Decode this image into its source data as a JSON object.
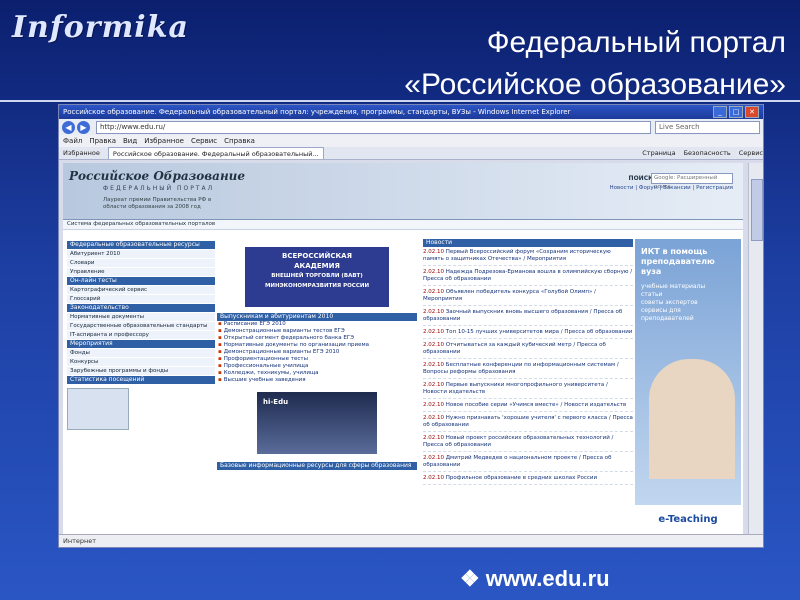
{
  "slide": {
    "logo": "Informika",
    "title_line1": "Федеральный портал",
    "title_line2": "«Российское образование»",
    "footer_bullet": "❖",
    "footer_url": "www.edu.ru"
  },
  "browser": {
    "title": "Российское образование. Федеральный образовательный портал: учреждения, программы, стандарты, ВУЗы - Windows Internet Explorer",
    "win_buttons": [
      "_",
      "□",
      "✕"
    ],
    "back_label": "◀",
    "forward_label": "▶",
    "url": "http://www.edu.ru/",
    "search_placeholder": "Live Search",
    "menu": [
      "Файл",
      "Правка",
      "Вид",
      "Избранное",
      "Сервис",
      "Справка"
    ],
    "fav_label": "Избранное",
    "tab_label": "Российское образование. Федеральный образовательный...",
    "tools": [
      "Страница",
      "Безопасность",
      "Сервис"
    ],
    "status": "Интернет"
  },
  "site": {
    "logo": "Российское Образование",
    "subtitle": "ФЕДЕРАЛЬНЫЙ ПОРТАЛ",
    "banner": "Лауреат премии Правительства РФ в области образования за 2008 год",
    "search_label": "ПОИСК",
    "search_placeholder": "Google: Расширенный поиск",
    "links": "Новости | Форум | Вакансии | Регистрация",
    "crumb": "Система федеральных образовательных порталов"
  },
  "left_nav": [
    {
      "text": "Федеральные образовательные ресурсы",
      "kind": "head"
    },
    {
      "text": "Абитуриент 2010",
      "kind": "item"
    },
    {
      "text": "Словари",
      "kind": "item"
    },
    {
      "text": "Управление",
      "kind": "item"
    },
    {
      "text": "Он-лайн тесты",
      "kind": "head"
    },
    {
      "text": "Картографический сервис",
      "kind": "item"
    },
    {
      "text": "Глоссарий",
      "kind": "item"
    },
    {
      "text": "Законодательство",
      "kind": "head"
    },
    {
      "text": "Нормативные документы",
      "kind": "item"
    },
    {
      "text": "Государственные образовательные стандарты",
      "kind": "item"
    },
    {
      "text": "IT-аспиранта и профессору",
      "kind": "item"
    },
    {
      "text": "Мероприятия",
      "kind": "head"
    },
    {
      "text": "Фонды",
      "kind": "item"
    },
    {
      "text": "Конкурсы",
      "kind": "item"
    },
    {
      "text": "Зарубежные программы и фонды",
      "kind": "item"
    },
    {
      "text": "Статистика посещений",
      "kind": "head"
    }
  ],
  "mid": {
    "banner_line1": "ВСЕРОССИЙСКАЯ",
    "banner_line2": "АКАДЕМИЯ",
    "banner_line3": "ВНЕШНЕЙ ТОРГОВЛИ (ВАВТ)",
    "banner_line4": "МИНЭКОНОМРАЗВИТИЯ РОССИИ",
    "head": "Выпускникам и абитуриентам 2010",
    "items": [
      "Расписание ЕГЭ 2010",
      "Демонстрационные варианты тестов ЕГЭ",
      "Открытый сегмент федерального банка ЕГЭ",
      "Нормативные документы по организации приема",
      "Демонстрационные варианты ЕГЭ 2010",
      "Профориентационные тесты",
      "Профессиональные училища",
      "Колледжи, техникумы, училища",
      "Высшие учебные заведения"
    ],
    "photo_label": "hi-Edu",
    "bottom_head": "Базовые информационные ресурсы для сферы образования"
  },
  "news": {
    "head": "Новости",
    "items": [
      {
        "date": "2.02.10",
        "text": "Первый Всероссийский форум «Сохраним историческую память о защитниках Отечества» / Мероприятия"
      },
      {
        "date": "2.02.10",
        "text": "Надежда Подрезова-Ерманова вошла в олимпийскую сборную / Пресса об образовании"
      },
      {
        "date": "2.02.10",
        "text": "Объявлен победитель конкурса «Голубой Олимп» / Мероприятия"
      },
      {
        "date": "2.02.10",
        "text": "Заочный выпускник вновь высшего образования / Пресса об образовании"
      },
      {
        "date": "2.02.10",
        "text": "Топ 10-15 лучших университетов мира / Пресса об образовании"
      },
      {
        "date": "2.02.10",
        "text": "Отчитываться за каждый кубический метр / Пресса об образовании"
      },
      {
        "date": "2.02.10",
        "text": "Бесплатные конференции по информационным системам / Вопросы реформы образования"
      },
      {
        "date": "2.02.10",
        "text": "Первые выпускники многопрофильного университета / Новости издательств"
      },
      {
        "date": "2.02.10",
        "text": "Новое пособие серии «Учимся вместе» / Новости издательств"
      },
      {
        "date": "2.02.10",
        "text": "Нужно признавать 'хорошие учителя' с первого класса / Пресса об образовании"
      },
      {
        "date": "2.02.10",
        "text": "Новый проект российских образовательных технологий / Пресса об образовании"
      },
      {
        "date": "2.02.10",
        "text": "Дмитрий Медведев о национальном проекте / Пресса об образовании"
      },
      {
        "date": "2.02.10",
        "text": "Профильное образование в средних школах России"
      }
    ]
  },
  "ad": {
    "title": "ИКТ в помощь преподавателю вуза",
    "items": [
      "учебные материалы",
      "статьи",
      "советы экспертов",
      "сервисы для преподавателей"
    ],
    "footer": "e-Teaching"
  }
}
